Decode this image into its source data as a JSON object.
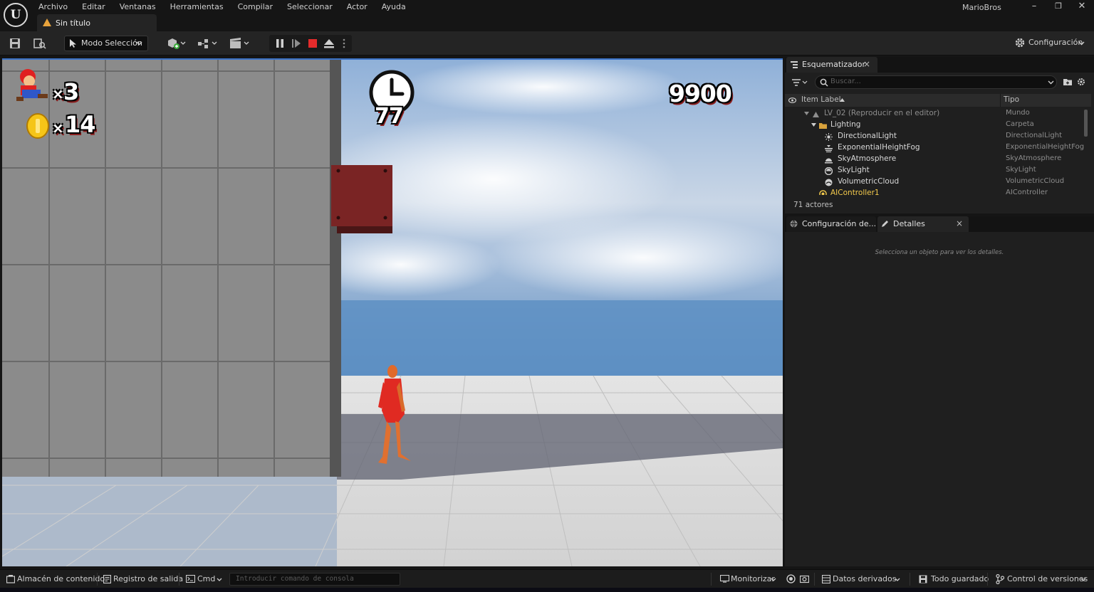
{
  "app": {
    "project_name": "MarioBros",
    "document_tab": "Sin título"
  },
  "menu": [
    "Archivo",
    "Editar",
    "Ventanas",
    "Herramientas",
    "Compilar",
    "Seleccionar",
    "Actor",
    "Ayuda"
  ],
  "window_controls": {
    "minimize": "–",
    "restore": "❐",
    "close": "✕"
  },
  "toolbar": {
    "mode_label": "Modo Selección",
    "settings_label": "Configuración"
  },
  "hud": {
    "lives": "3",
    "coins": "14",
    "timer": "77",
    "score": "9900",
    "multiplier": "×"
  },
  "outliner": {
    "tab_label": "Esquematizador",
    "search_placeholder": "Buscar...",
    "col_label": "Item Label",
    "col_type": "Tipo",
    "rows": [
      {
        "label": "LV_02 (Reproducir en el editor)",
        "type": "Mundo",
        "icon": "world-icon"
      },
      {
        "label": "Lighting",
        "type": "Carpeta",
        "icon": "folder-icon"
      },
      {
        "label": "DirectionalLight",
        "type": "DirectionalLight",
        "icon": "sun-icon"
      },
      {
        "label": "ExponentialHeightFog",
        "type": "ExponentialHeightFog",
        "icon": "fog-icon"
      },
      {
        "label": "SkyAtmosphere",
        "type": "SkyAtmosphere",
        "icon": "atmosphere-icon"
      },
      {
        "label": "SkyLight",
        "type": "SkyLight",
        "icon": "skylight-icon"
      },
      {
        "label": "VolumetricCloud",
        "type": "VolumetricCloud",
        "icon": "cloud-icon"
      },
      {
        "label": "AIController1",
        "type": "AIController",
        "icon": "controller-icon"
      }
    ],
    "actor_count": "71 actores"
  },
  "details": {
    "tab_world_settings": "Configuración de...",
    "tab_details": "Detalles",
    "hint": "Selecciona un objeto para ver los detalles."
  },
  "statusbar": {
    "content_browser": "Almacén de contenido",
    "output_log": "Registro de salida",
    "cmd": "Cmd",
    "cmd_placeholder": "Introducir comando de consola",
    "monitor": "Monitorizar",
    "derived_data": "Datos derivados",
    "all_saved": "Todo guardado",
    "version_control": "Control de versiones"
  },
  "colors": {
    "accent_blue": "#3b73c8",
    "stop_red": "#e52b2b",
    "warning_orange": "#e8a33c",
    "selected_yellow": "#f2c94c"
  }
}
